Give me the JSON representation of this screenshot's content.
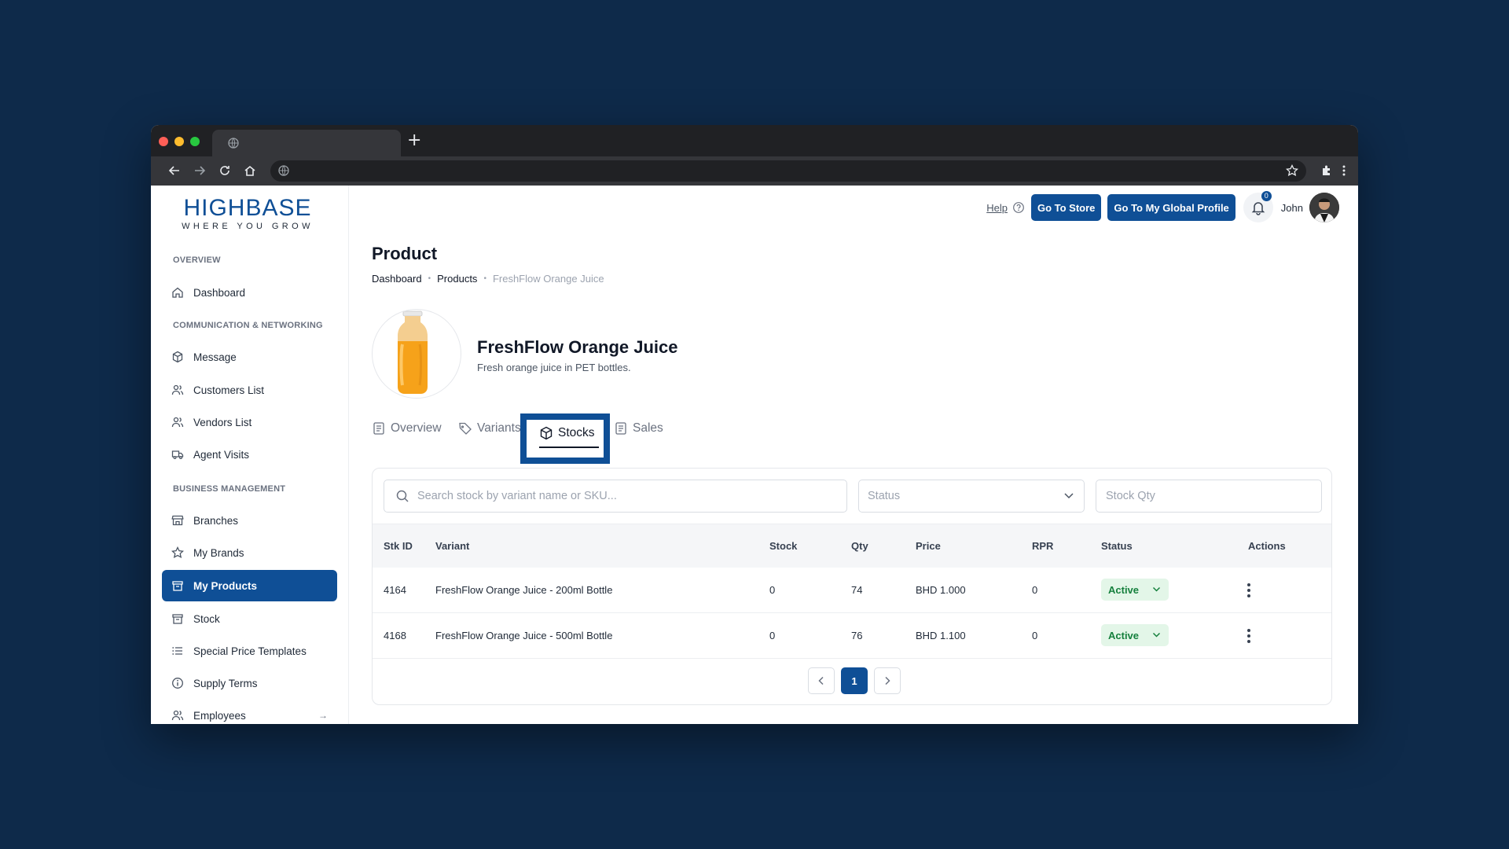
{
  "brand": {
    "name": "HIGHBASE",
    "tagline": "WHERE YOU GROW"
  },
  "sidebar": {
    "sections": [
      {
        "title": "OVERVIEW"
      },
      {
        "title": "COMMUNICATION & NETWORKING"
      },
      {
        "title": "BUSINESS MANAGEMENT"
      }
    ],
    "items": [
      {
        "label": "Dashboard",
        "icon": "home-icon"
      },
      {
        "label": "Message",
        "icon": "cube-icon"
      },
      {
        "label": "Customers List",
        "icon": "users-icon"
      },
      {
        "label": "Vendors List",
        "icon": "users-icon"
      },
      {
        "label": "Agent Visits",
        "icon": "truck-icon"
      },
      {
        "label": "Branches",
        "icon": "store-icon"
      },
      {
        "label": "My Brands",
        "icon": "star-icon"
      },
      {
        "label": "My Products",
        "icon": "box-icon",
        "active": true
      },
      {
        "label": "Stock",
        "icon": "box-icon"
      },
      {
        "label": "Special Price Templates",
        "icon": "list-icon"
      },
      {
        "label": "Supply Terms",
        "icon": "info-icon"
      },
      {
        "label": "Employees",
        "icon": "users-icon",
        "arrow": "→"
      }
    ]
  },
  "header": {
    "help": "Help",
    "go_to_store": "Go To Store",
    "global_profile": "Go To My Global Profile",
    "notifications": "0",
    "user": "John"
  },
  "page": {
    "title": "Product",
    "breadcrumb": [
      "Dashboard",
      "Products",
      "FreshFlow Orange Juice"
    ]
  },
  "product": {
    "name": "FreshFlow Orange Juice",
    "description": "Fresh orange juice in PET bottles."
  },
  "tabs": [
    {
      "label": "Overview",
      "icon": "document-icon"
    },
    {
      "label": "Variants",
      "icon": "tag-icon"
    },
    {
      "label": "Stocks",
      "icon": "cube-icon",
      "active": true
    },
    {
      "label": "Sales",
      "icon": "document-icon"
    }
  ],
  "filters": {
    "search_placeholder": "Search stock by variant name or SKU...",
    "status_placeholder": "Status",
    "qty_placeholder": "Stock Qty"
  },
  "table": {
    "columns": [
      "Stk ID",
      "Variant",
      "Stock",
      "Qty",
      "Price",
      "RPR",
      "Status",
      "Actions"
    ],
    "rows": [
      {
        "id": "4164",
        "variant": "FreshFlow Orange Juice - 200ml Bottle",
        "stock": "0",
        "qty": "74",
        "price": "BHD 1.000",
        "rpr": "0",
        "status": "Active"
      },
      {
        "id": "4168",
        "variant": "FreshFlow Orange Juice - 500ml Bottle",
        "stock": "0",
        "qty": "76",
        "price": "BHD 1.100",
        "rpr": "0",
        "status": "Active"
      }
    ]
  },
  "pagination": {
    "current": "1"
  },
  "colors": {
    "primary": "#0f4f96",
    "background": "#0e2a4a",
    "active_badge_bg": "#e3f6e8",
    "active_badge_text": "#15803d"
  }
}
